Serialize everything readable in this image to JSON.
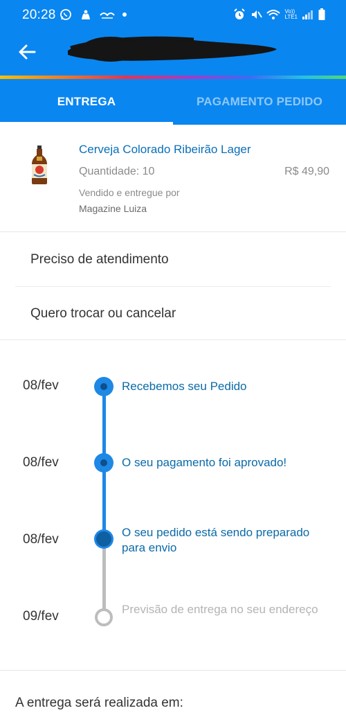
{
  "status_bar": {
    "time": "20:28",
    "network_label_top": "Vo))",
    "network_label_bottom": "LTE1"
  },
  "header": {
    "back_icon": "arrow-left-icon"
  },
  "tabs": [
    {
      "label": "ENTREGA",
      "selected": true
    },
    {
      "label": "PAGAMENTO PEDIDO",
      "selected": false
    }
  ],
  "product": {
    "name": "Cerveja Colorado Ribeirão Lager",
    "quantity": "Quantidade: 10",
    "price": "R$ 49,90",
    "sold_by": "Vendido e entregue por",
    "seller": "Magazine Luiza"
  },
  "actions": [
    {
      "label": "Preciso de atendimento"
    },
    {
      "label": "Quero trocar ou cancelar"
    }
  ],
  "timeline": [
    {
      "date": "08/fev",
      "text": "Recebemos seu Pedido",
      "status": "done"
    },
    {
      "date": "08/fev",
      "text": "O seu pagamento foi aprovado!",
      "status": "done"
    },
    {
      "date": "08/fev",
      "text": "O seu pedido está sendo preparado para envio",
      "status": "current"
    },
    {
      "date": "09/fev",
      "text": "Previsão de entrega no seu endereço",
      "status": "pending"
    }
  ],
  "delivery": {
    "heading": "A entrega será realizada em:"
  },
  "colors": {
    "brand_blue": "#0a86f0",
    "link_blue": "#0a6fb8",
    "timeline_active": "#1e88e5",
    "timeline_current": "#0f5fa3",
    "timeline_pending": "#bdbdbd"
  }
}
